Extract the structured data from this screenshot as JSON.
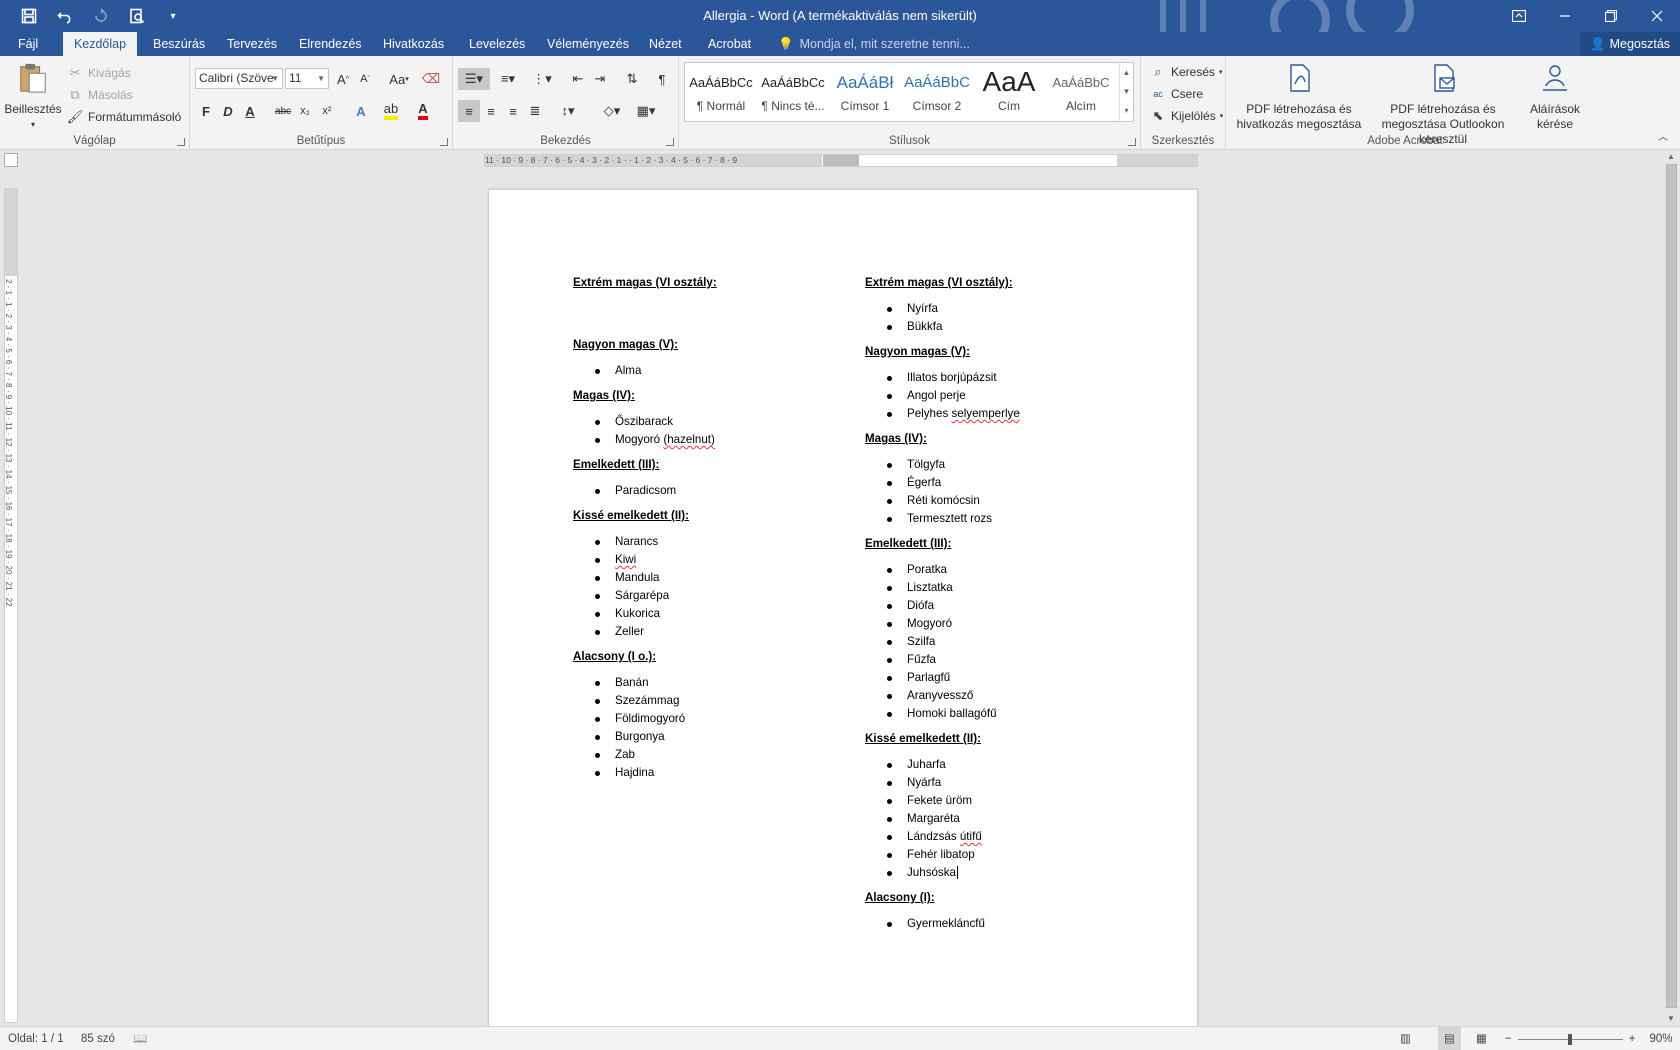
{
  "window": {
    "title": "Allergia - Word (A termékaktiválás nem sikerült)"
  },
  "tabs": [
    {
      "label": "Fájl",
      "active": false
    },
    {
      "label": "Kezdőlap",
      "active": true
    },
    {
      "label": "Beszúrás",
      "active": false
    },
    {
      "label": "Tervezés",
      "active": false
    },
    {
      "label": "Elrendezés",
      "active": false
    },
    {
      "label": "Hivatkozás",
      "active": false
    },
    {
      "label": "Levelezés",
      "active": false
    },
    {
      "label": "Véleményezés",
      "active": false
    },
    {
      "label": "Nézet",
      "active": false
    },
    {
      "label": "Acrobat",
      "active": false
    }
  ],
  "tellme": {
    "placeholder": "Mondja el, mit szeretne tenni..."
  },
  "share": {
    "label": "Megosztás"
  },
  "ribbon": {
    "clipboard": {
      "group": "Vágólap",
      "paste": "Beillesztés",
      "cut": "Kivágás",
      "copy": "Másolás",
      "format_painter": "Formátummásoló"
    },
    "font": {
      "group": "Betűtípus",
      "name": "Calibri (Szöve",
      "size": "11",
      "aa": "Aa",
      "bold": "F",
      "italic": "D",
      "underline": "A",
      "strike": "abc",
      "sub": "x₂",
      "sup": "x²"
    },
    "paragraph": {
      "group": "Bekezdés",
      "pilcrow": "¶"
    },
    "styles": {
      "group": "Stílusok",
      "items": [
        {
          "preview": "AaÁáBbCc",
          "name": "¶ Normál"
        },
        {
          "preview": "AaÁáBbCc",
          "name": "¶ Nincs té..."
        },
        {
          "preview": "AaÁáBł",
          "name": "Címsor 1"
        },
        {
          "preview": "AaÁáBbC",
          "name": "Címsor 2"
        },
        {
          "preview": "AaA",
          "name": "Cím"
        },
        {
          "preview": "AaÁáBbC",
          "name": "Alcím"
        }
      ]
    },
    "editing": {
      "group": "Szerkesztés",
      "find": "Keresés",
      "replace": "Csere",
      "select": "Kijelölés"
    },
    "acrobat": {
      "group": "Adobe Acrobat",
      "create_link": "PDF létrehozása és hivatkozás megosztása",
      "create_outlook": "PDF létrehozása és megosztása Outlookon keresztül",
      "request_sign": "Aláírások kérése"
    }
  },
  "ruler": {
    "h": "11 · 10 · 9 · 8 · 7 · 6 · 5 · 4 · 3 · 2 · 1 ·  · 1 · 2 · 3 · 4 · 5 · 6 · 7 · 8 · 9",
    "v": "2 · 1 · 1 · 2 · 3 · 4 · 5 · 6 · 7 · 8 · 9 · 10 · 11 · 12 · 13 · 14 · 15 · 16 · 17 · 18 · 19 · 20 · 21 · 22"
  },
  "document": {
    "left": {
      "extreme": "Extrém magas (VI osztály:",
      "very_high": "Nagyon magas (V):",
      "very_high_items": [
        "Alma"
      ],
      "high": "Magas (IV):",
      "high_items": [
        "Őszibarack",
        "Mogyoró (hazelnut)"
      ],
      "raised": "Emelkedett (III):",
      "raised_items": [
        "Paradicsom"
      ],
      "slight": "Kissé emelkedett (II):",
      "slight_items": [
        "Narancs",
        "Kiwi",
        "Mandula",
        "Sárgarépa",
        "Kukorica",
        "Zeller"
      ],
      "low": "Alacsony (I o.):",
      "low_items": [
        "Banán",
        "Szezámmag",
        "Földimogyoró",
        "Burgonya",
        "Zab",
        "Hajdina"
      ]
    },
    "right": {
      "extreme": "Extrém magas (VI osztály):",
      "extreme_items": [
        "Nyírfa",
        "Bükkfa"
      ],
      "very_high": "Nagyon magas (V):",
      "very_high_items": [
        "Illatos borjúpázsit",
        "Angol perje",
        "Pelyhes selyemperlye"
      ],
      "high": "Magas (IV):",
      "high_items": [
        "Tölgyfa",
        "Égerfa",
        "Réti komócsin",
        "Termesztett rozs"
      ],
      "raised": "Emelkedett (III):",
      "raised_items": [
        "Poratka",
        "Lisztatka",
        "Diófa",
        "Mogyoró",
        "Szilfa",
        "Fűzfa",
        "Parlagfű",
        "Aranyvessző",
        "Homoki ballagófű"
      ],
      "slight": "Kissé emelkedett (II):",
      "slight_items": [
        "Juharfa",
        "Nyárfa",
        "Fekete üröm",
        "Margaréta",
        "Lándzsás útifű",
        "Fehér libatop",
        "Juhsóska"
      ],
      "low": "Alacsony (I):",
      "low_items": [
        "Gyermekláncfű"
      ]
    }
  },
  "status": {
    "page": "Oldal: 1 / 1",
    "words": "85 szó",
    "zoom": "90%",
    "zoom_minus": "−",
    "zoom_plus": "+"
  },
  "colors": {
    "brand": "#2b579a",
    "ribbon": "#f3f3f3",
    "spell": "#e33333"
  }
}
